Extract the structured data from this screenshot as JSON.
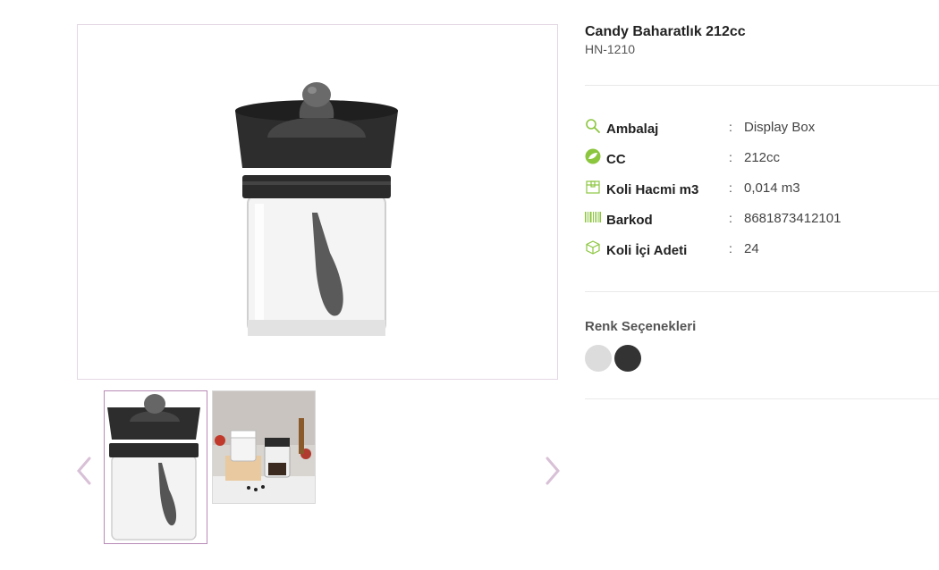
{
  "product": {
    "title": "Candy Baharatlık 212cc",
    "code": "HN-1210"
  },
  "gallery": {
    "main_image": "spice-jar-black-lid",
    "thumbnails": [
      "spice-jar-black-lid",
      "spice-jars-lifestyle"
    ],
    "active_index": 0,
    "prev_icon": "chevron-left-icon",
    "next_icon": "chevron-right-icon",
    "accent_color": "#cdb0cc"
  },
  "specs": [
    {
      "icon": "search-icon",
      "label": "Ambalaj",
      "separator": ":",
      "value": "Display Box"
    },
    {
      "icon": "leaf-badge-icon",
      "label": "CC",
      "separator": ":",
      "value": "212cc"
    },
    {
      "icon": "box-icon",
      "label": "Koli Hacmi m3",
      "separator": ":",
      "value": "0,014 m3"
    },
    {
      "icon": "barcode-icon",
      "label": "Barkod",
      "separator": ":",
      "value": "8681873412101"
    },
    {
      "icon": "cube-icon",
      "label": "Koli İçi Adeti",
      "separator": ":",
      "value": "24"
    }
  ],
  "colors": {
    "title": "Renk Seçenekleri",
    "options": [
      "#dcdcdc",
      "#333333"
    ]
  },
  "theme": {
    "icon_green": "#8cc63f",
    "border_purple": "#b98bb6"
  }
}
